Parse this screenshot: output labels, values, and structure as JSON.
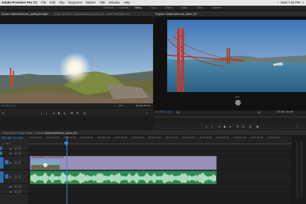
{
  "menubar": {
    "app": "Adobe Premiere Pro CC",
    "items": [
      "File",
      "Edit",
      "Clip",
      "Sequence",
      "Marker",
      "Title",
      "Window",
      "Help"
    ],
    "clock": "Wed 7:34 PM"
  },
  "workspaces": [
    "All Panels",
    "Assembly",
    "Editing",
    "Color",
    "Effects",
    "Audio",
    "Titles",
    "Libraries"
  ],
  "source": {
    "tabs": [
      "Source: GoldenGateDrone_stereo_011.mp4",
      "Effect Controls",
      "Audio Clip Mixer: GoldenGateDrone_stereo_011",
      "Audio Track Mixer: Se"
    ],
    "timecode_left": "00:00:11:02",
    "zoom": "1/2",
    "timecode_right": "00:00:00:00"
  },
  "program": {
    "title": "Program: GoldenGateDrone_stereo_011",
    "timecode_left": "00:00:11:02",
    "fit": "Fit",
    "zoom": "1/2",
    "timecode_right": "00:00:30:00",
    "angle_readout": "45.0°"
  },
  "timeline": {
    "tabs": [
      "Drone Stock Footage Media 4 - Sequence",
      "GoldenGateDrone_stereo_011"
    ],
    "timecode": "00:00:11:02",
    "ticks": [
      "00:00:00:00",
      "00:00:02:00",
      "00:00:04:00",
      "00:00:06:00",
      "00:00:08:00",
      "00:00:10:00",
      "00:00:12:00",
      "00:00:14:00",
      "00:00:16:00",
      "00:00:18:00",
      "00:00:20:00",
      "00:00:22:00",
      "00:00:24:00",
      "00:00:26:00",
      "00:00:28:00"
    ],
    "tracks": [
      "V3",
      "V2",
      "V1",
      "A1",
      "A2",
      "A3"
    ],
    "clip_label": "GoldenGateDrone_stereo_011.mp4 [V]"
  },
  "colors": {
    "accent": "#2d8ceb",
    "clip_video": "#9a8fb8",
    "clip_audio": "#33a45f"
  }
}
